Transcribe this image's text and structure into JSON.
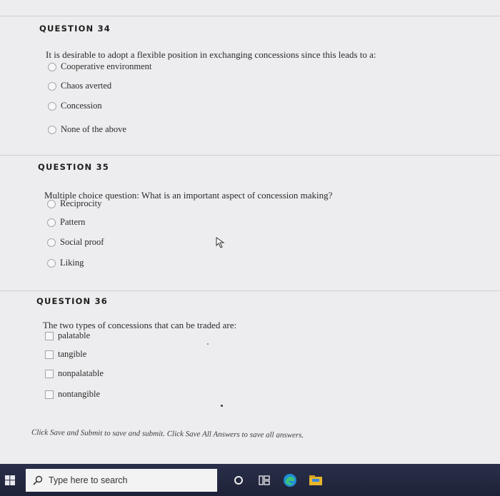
{
  "questions": [
    {
      "header": "QUESTION 34",
      "text": "It is desirable to adopt a flexible position in exchanging concessions since this leads to a:",
      "input_type": "radio",
      "options": [
        "Cooperative environment",
        "Chaos averted",
        "Concession",
        "None of the above"
      ]
    },
    {
      "header": "QUESTION 35",
      "text": "Multiple choice question: What is an important aspect of concession making?",
      "input_type": "radio",
      "options": [
        "Reciprocity",
        "Pattern",
        "Social proof",
        "Liking"
      ]
    },
    {
      "header": "QUESTION 36",
      "text": "The two types of concessions that can be traded are:",
      "input_type": "checkbox",
      "options": [
        "palatable",
        "tangible",
        "nonpalatable",
        "nontangible"
      ]
    }
  ],
  "footer_note": "Click Save and Submit to save and submit. Click Save All Answers to save all answers.",
  "taskbar": {
    "search_placeholder": "Type here to search",
    "icons": [
      "windows-start-icon",
      "search-icon",
      "cortana-icon",
      "task-view-icon",
      "edge-icon",
      "file-explorer-icon"
    ]
  }
}
